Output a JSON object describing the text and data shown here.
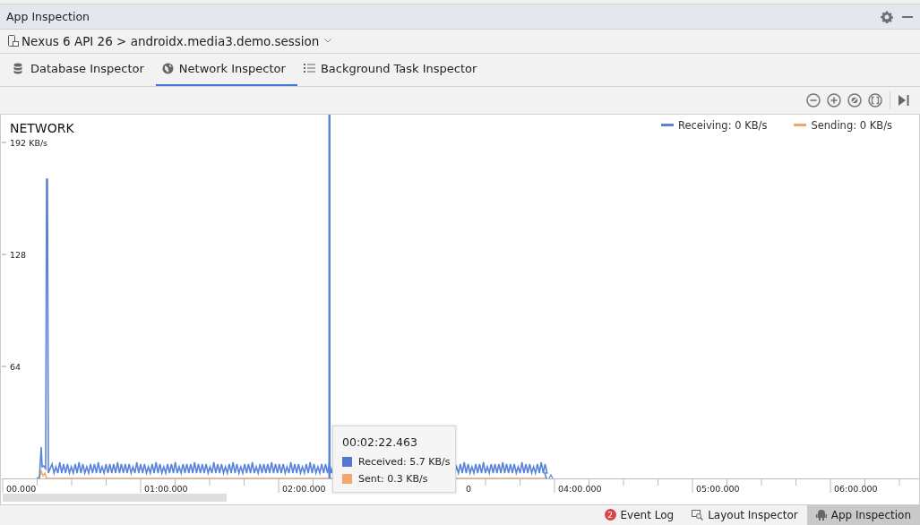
{
  "panel": {
    "title": "App Inspection"
  },
  "device_selector": {
    "label": "Nexus 6 API 26 > androidx.media3.demo.session"
  },
  "tabs": [
    {
      "label": "Database Inspector",
      "kind": "database",
      "selected": false
    },
    {
      "label": "Network Inspector",
      "kind": "globe",
      "selected": true
    },
    {
      "label": "Background Task Inspector",
      "kind": "list",
      "selected": false
    }
  ],
  "toolbar": [
    {
      "kind": "zoom-out"
    },
    {
      "kind": "zoom-in"
    },
    {
      "kind": "reset"
    },
    {
      "kind": "fit"
    },
    {
      "kind": "end"
    }
  ],
  "network_chart": {
    "title": "NETWORK",
    "y_labels": [
      "192 KB/s",
      "128",
      "64"
    ],
    "x_labels": [
      "00.000",
      "01:00.000",
      "02:00.000",
      "0",
      "04:00.000",
      "05:00.000",
      "06:00.000"
    ],
    "legend": [
      {
        "label": "Receiving: 0 KB/s",
        "color": "#5a84d6"
      },
      {
        "label": "Sending: 0 KB/s",
        "color": "#f3a766"
      }
    ],
    "tooltip": {
      "time": "00:02:22.463",
      "rows": [
        {
          "label": "Received: 5.7 KB/s",
          "color": "#5079cc"
        },
        {
          "label": "Sent: 0.3 KB/s",
          "color": "#f0a870"
        }
      ]
    }
  },
  "status_bar": [
    {
      "label": "Event Log",
      "kind": "badge",
      "badge": "2",
      "selected": false
    },
    {
      "label": "Layout Inspector",
      "kind": "layout",
      "selected": false
    },
    {
      "label": "App Inspection",
      "kind": "robot",
      "selected": true
    }
  ]
}
